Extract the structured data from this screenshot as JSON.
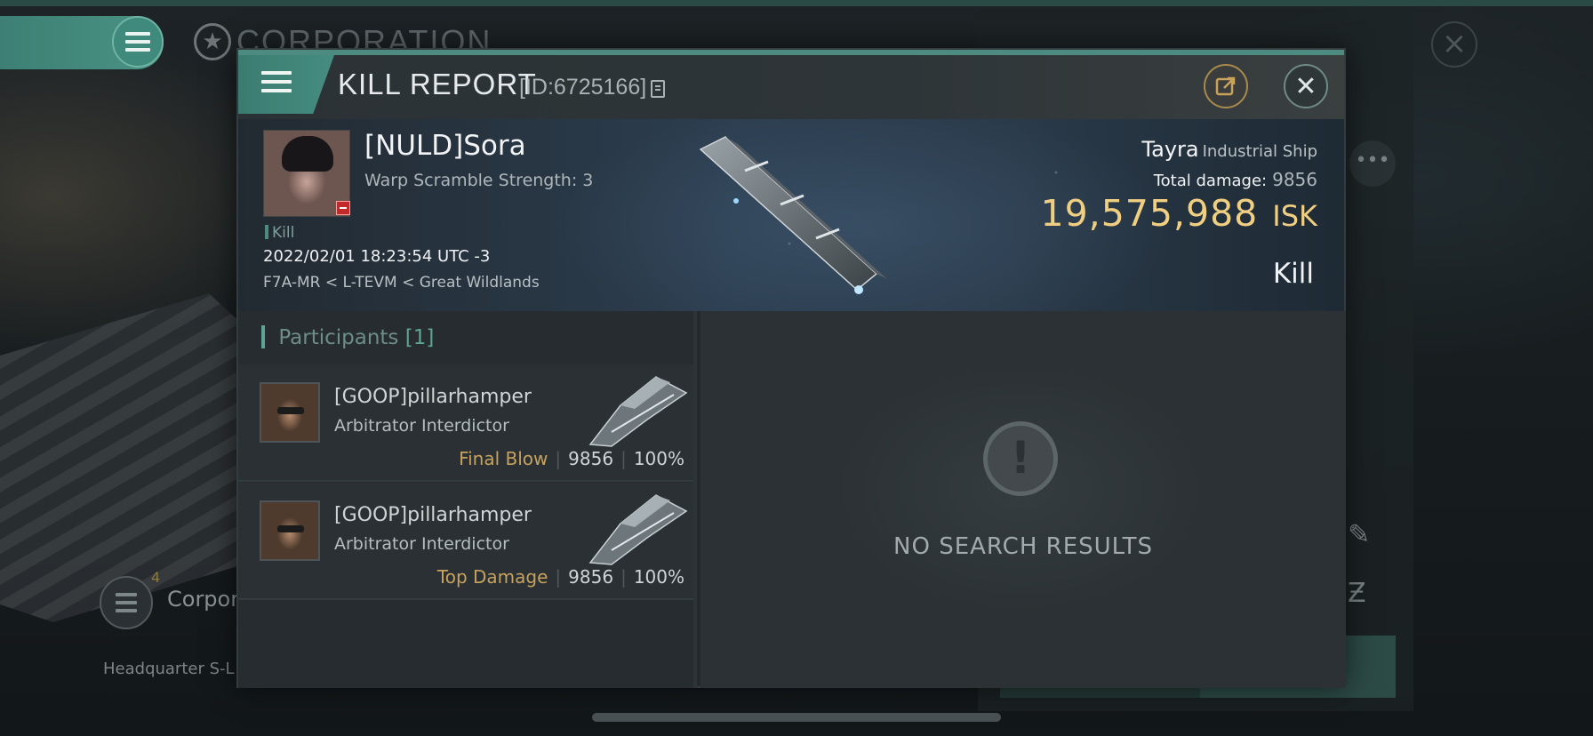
{
  "background": {
    "corp_title": "CORPORATION",
    "corp_label": "Corpora",
    "hq_label": "Headquarter S-L",
    "badge": "4"
  },
  "dialog": {
    "title": "KILL REPORT",
    "id": "[ID:6725166]",
    "victim": {
      "name": "[NULD]Sora",
      "subtitle": "Warp Scramble Strength: 3",
      "tag": "Kill",
      "timestamp": "2022/02/01 18:23:54 UTC -3",
      "location": "F7A-MR < L-TEVM < Great Wildlands"
    },
    "ship": {
      "name": "Tayra",
      "class": "Industrial Ship",
      "damage_label": "Total damage:",
      "damage_value": "9856",
      "isk_value": "19,575,988",
      "isk_unit": "ISK",
      "result": "Kill"
    },
    "participants": {
      "label": "Participants",
      "count": "[1]",
      "rows": [
        {
          "name": "[GOOP]pillarhamper",
          "ship": "Arbitrator Interdictor",
          "tag": "Final Blow",
          "damage": "9856",
          "percent": "100%"
        },
        {
          "name": "[GOOP]pillarhamper",
          "ship": "Arbitrator Interdictor",
          "tag": "Top Damage",
          "damage": "9856",
          "percent": "100%"
        }
      ]
    },
    "empty_state": "NO SEARCH RESULTS"
  },
  "colors": {
    "accent": "#4d8a80",
    "isk": "#f1cf82",
    "tag": "#c7a25e",
    "loss_badge": "#c22a2a"
  }
}
